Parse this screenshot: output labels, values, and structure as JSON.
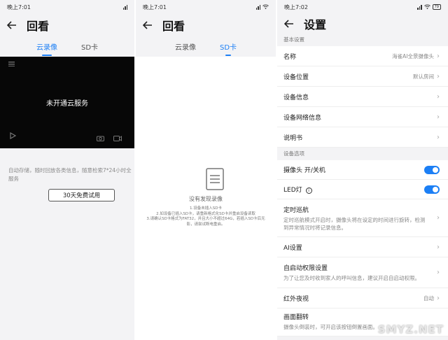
{
  "screen1": {
    "status_time": "晚上7:01",
    "title": "回看",
    "tabs": [
      "云录像",
      "SD卡"
    ],
    "active_tab": 0,
    "video_text": "未开通云服务",
    "description": "自动存储，随时回放各类信息，随意检索7*24小时全服务",
    "trial_button": "30天免费试用"
  },
  "screen2": {
    "status_time": "晚上7:01",
    "title": "回看",
    "tabs": [
      "云录像",
      "SD卡"
    ],
    "active_tab": 1,
    "empty_title": "没有发现录像",
    "tips": [
      "1.设备未插入SD卡",
      "2.如设备已插入SD卡，请重新格式化SD卡并重启设备读取",
      "3.请确认SD卡格式为FAT32，并且大小不超过64G，若插入SD卡后无",
      "影，请尝试断电重启。"
    ]
  },
  "screen3": {
    "status_time": "晚上7:02",
    "battery": "79",
    "title": "设置",
    "section_basic": "基本设置",
    "name_label": "名称",
    "name_value": "海雀AI全景摄像头",
    "location_label": "设备位置",
    "location_value": "默认房间",
    "info_label": "设备信息",
    "network_label": "设备网络信息",
    "manual_label": "说明书",
    "section_options": "设备选项",
    "camera_switch_label": "摄像头 开/关机",
    "camera_switch_on": true,
    "led_label": "LED灯",
    "led_on": true,
    "patrol_label": "定时巡航",
    "patrol_sub": "定时巡航模式开启时，摄像头将在设定的时间进行旋转，检测到异常情况时将记录信息。",
    "ai_label": "AI设置",
    "autostart_label": "自启动权限设置",
    "autostart_sub": "为了让您及时收到家人的呼叫信息，建议开启自启动权限。",
    "night_label": "红外夜视",
    "night_value": "自动",
    "flip_label": "画面翻转",
    "flip_sub": "摄像头倒装时，可开启该按钮倒置画面。"
  },
  "watermark": "SMYZ.NET"
}
